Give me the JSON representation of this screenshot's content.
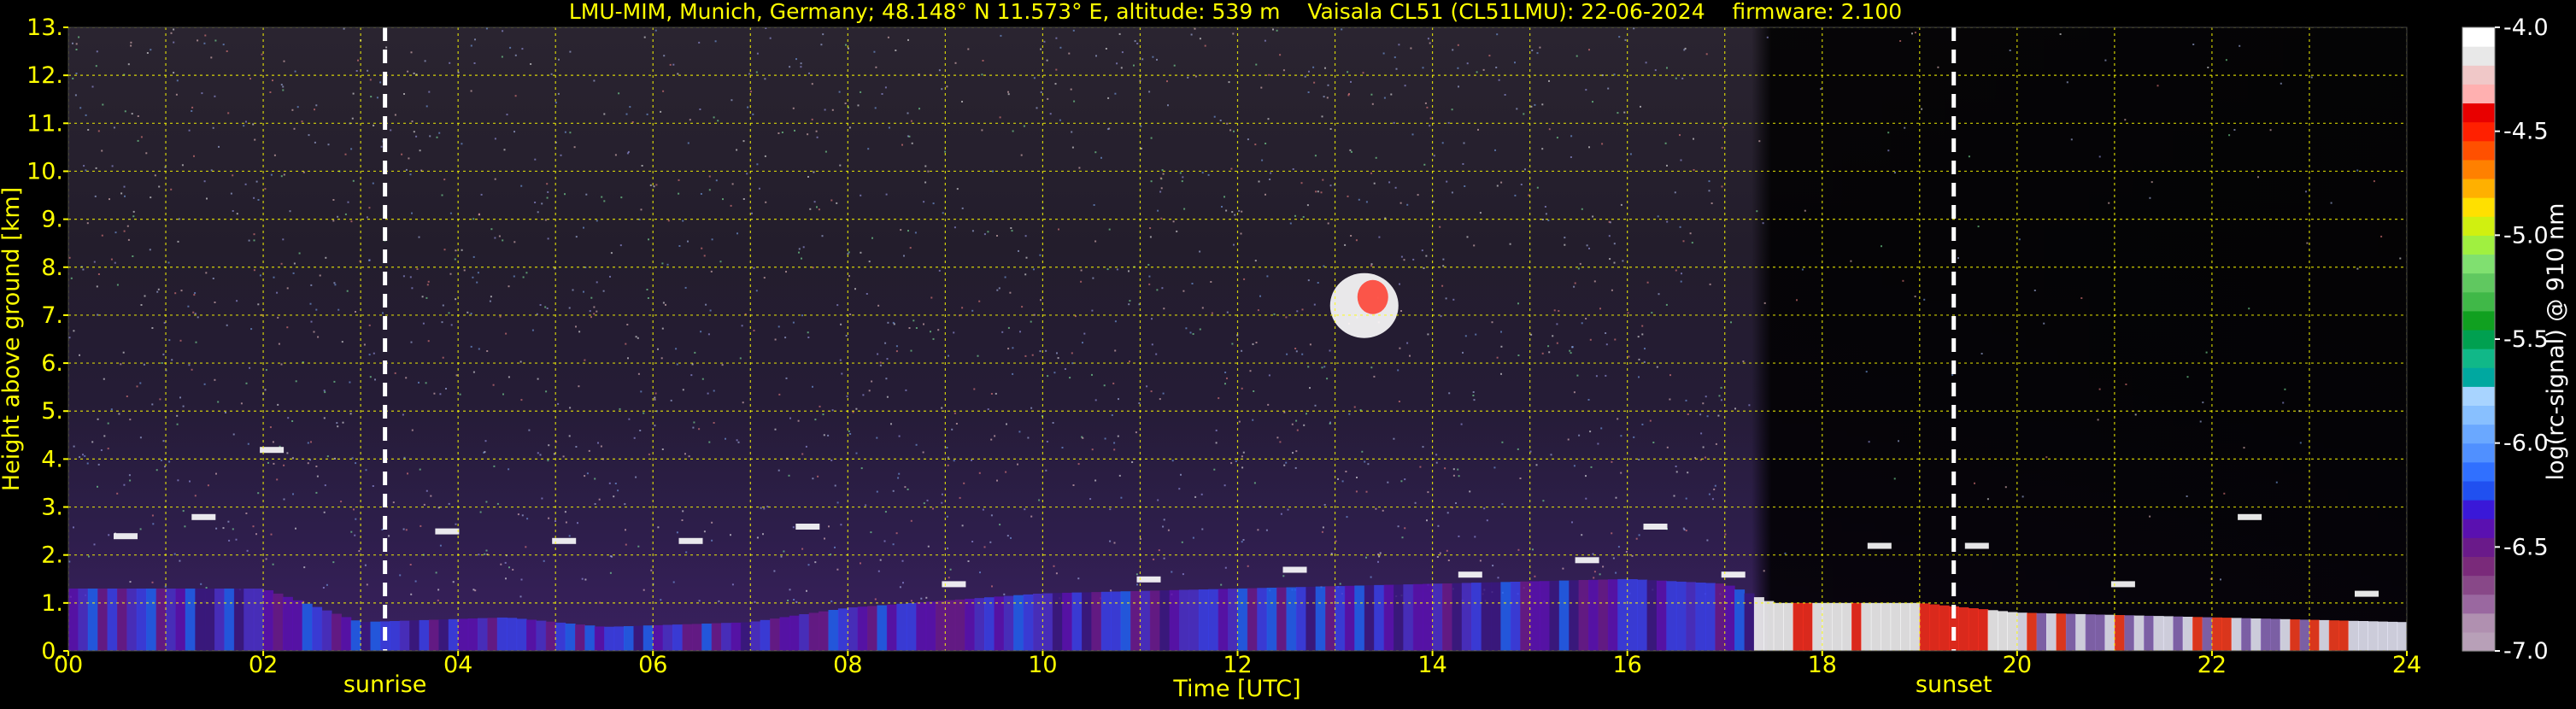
{
  "title": "LMU-MIM, Munich, Germany; 48.148° N 11.573° E, altitude: 539 m    Vaisala CL51 (CL51LMU): 22-06-2024    firmware: 2.100",
  "colors": {
    "background": "#000000",
    "text": "#ffff00",
    "grid": "#ffff00",
    "marker_line": "#ffffff",
    "colorbar_text": "#ffffff"
  },
  "chart_data": {
    "type": "heatmap",
    "xlabel": "Time [UTC]",
    "ylabel": "Height above ground [km]",
    "xlim": [
      0,
      24
    ],
    "ylim": [
      0,
      13
    ],
    "x_ticks": [
      "00",
      "02",
      "04",
      "06",
      "08",
      "10",
      "12",
      "14",
      "16",
      "18",
      "20",
      "22",
      "24"
    ],
    "y_ticks": [
      "0.",
      "1.",
      "2.",
      "3.",
      "4.",
      "5.",
      "6.",
      "7.",
      "8.",
      "9.",
      "10.",
      "11.",
      "12.",
      "13."
    ],
    "grid": true,
    "markers": [
      {
        "label": "sunrise",
        "time_hours": 3.25
      },
      {
        "label": "sunset",
        "time_hours": 19.35
      }
    ],
    "features": {
      "boundary_layer_top_km": [
        [
          0.0,
          1.3
        ],
        [
          2.0,
          1.3
        ],
        [
          3.0,
          0.6
        ],
        [
          4.5,
          0.7
        ],
        [
          5.5,
          0.5
        ],
        [
          7.0,
          0.6
        ],
        [
          8.0,
          0.9
        ],
        [
          10.0,
          1.2
        ],
        [
          12.0,
          1.3
        ],
        [
          14.0,
          1.4
        ],
        [
          16.0,
          1.5
        ],
        [
          17.0,
          1.4
        ],
        [
          17.5,
          1.0
        ],
        [
          19.0,
          1.0
        ],
        [
          20.0,
          0.8
        ],
        [
          22.0,
          0.7
        ],
        [
          24.0,
          0.6
        ]
      ],
      "cloud_layer_km": [
        [
          0.5,
          2.4
        ],
        [
          1.3,
          2.8
        ],
        [
          2.0,
          4.2
        ],
        [
          3.8,
          2.5
        ],
        [
          5.0,
          2.3
        ],
        [
          6.3,
          2.3
        ],
        [
          7.5,
          2.6
        ],
        [
          9.0,
          1.4
        ],
        [
          11.0,
          1.5
        ],
        [
          12.5,
          1.7
        ],
        [
          14.3,
          1.6
        ],
        [
          15.5,
          1.9
        ],
        [
          16.2,
          2.6
        ],
        [
          17.0,
          1.6
        ],
        [
          18.5,
          2.2
        ],
        [
          19.5,
          2.2
        ],
        [
          21.0,
          1.4
        ],
        [
          22.3,
          2.8
        ],
        [
          23.5,
          1.2
        ]
      ],
      "high_cloud_center": {
        "time_hours": 13.3,
        "height_km": 7.2
      }
    },
    "colorbar": {
      "label": "log(rc-signal) @ 910 nm",
      "range": [
        -7.0,
        -4.0
      ],
      "tick_labels": [
        "-4.0",
        "-4.5",
        "-5.0",
        "-5.5",
        "-6.0",
        "-6.5",
        "-7.0"
      ],
      "colors": [
        "#b8a0b8",
        "#b090b0",
        "#9a68a0",
        "#884888",
        "#7a2a7a",
        "#6a1a8a",
        "#5a10b0",
        "#3a18d8",
        "#2050f0",
        "#3070ff",
        "#5090ff",
        "#6aa8ff",
        "#88c0ff",
        "#a8d4ff",
        "#00a8a0",
        "#10b888",
        "#00a050",
        "#10a020",
        "#40b848",
        "#60c860",
        "#80e070",
        "#a0f040",
        "#d0f010",
        "#ffe000",
        "#ffb000",
        "#ff8000",
        "#ff5000",
        "#ff2000",
        "#e80000",
        "#ffb0b0",
        "#f0c8c8",
        "#e8e8e8",
        "#ffffff"
      ]
    }
  }
}
